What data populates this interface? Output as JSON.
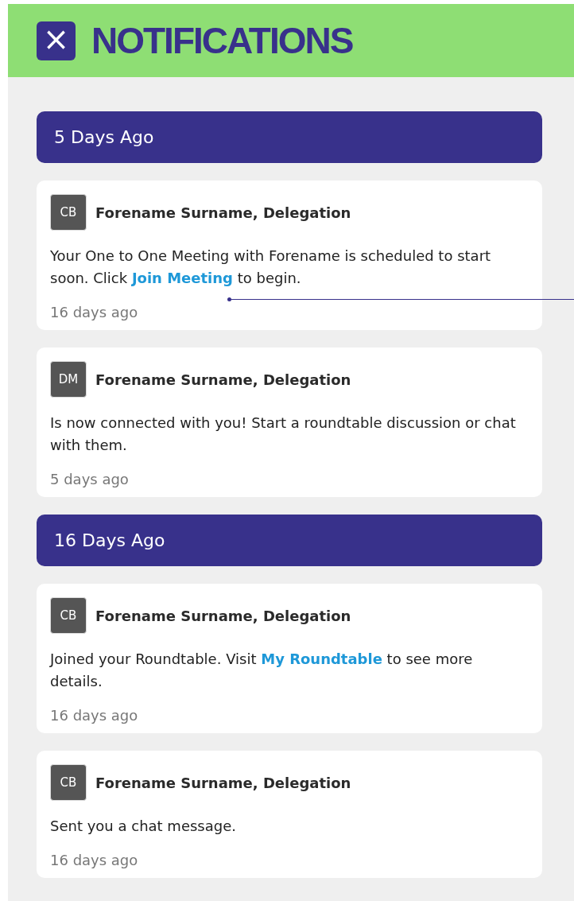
{
  "header": {
    "close_label": "×",
    "title": "NOTIFICATIONS"
  },
  "sections": [
    {
      "title": "5 Days Ago",
      "notifications": [
        {
          "initials": "CB",
          "sender": "Forename Surname, Delegation",
          "message": [
            {
              "kind": "text",
              "text": "Your One to One Meeting with Forename is scheduled to start soon. Click "
            },
            {
              "kind": "link",
              "text": "Join Meeting"
            },
            {
              "kind": "text",
              "text": " to begin."
            }
          ],
          "time": "16 days ago"
        },
        {
          "initials": "DM",
          "sender": "Forename Surname, Delegation",
          "message": [
            {
              "kind": "text",
              "text": "Is now connected with you! Start a roundtable discussion or chat with them."
            }
          ],
          "time": "5 days ago"
        }
      ]
    },
    {
      "title": "16 Days Ago",
      "notifications": [
        {
          "initials": "CB",
          "sender": "Forename Surname, Delegation",
          "message": [
            {
              "kind": "text",
              "text": "Joined your Roundtable. Visit  "
            },
            {
              "kind": "link",
              "text": "My Roundtable"
            },
            {
              "kind": "text",
              "text": " to see more details."
            }
          ],
          "time": "16 days ago"
        },
        {
          "initials": "CB",
          "sender": "Forename Surname, Delegation",
          "message": [
            {
              "kind": "text",
              "text": "Sent you a chat message."
            }
          ],
          "time": "16 days ago"
        }
      ]
    }
  ]
}
